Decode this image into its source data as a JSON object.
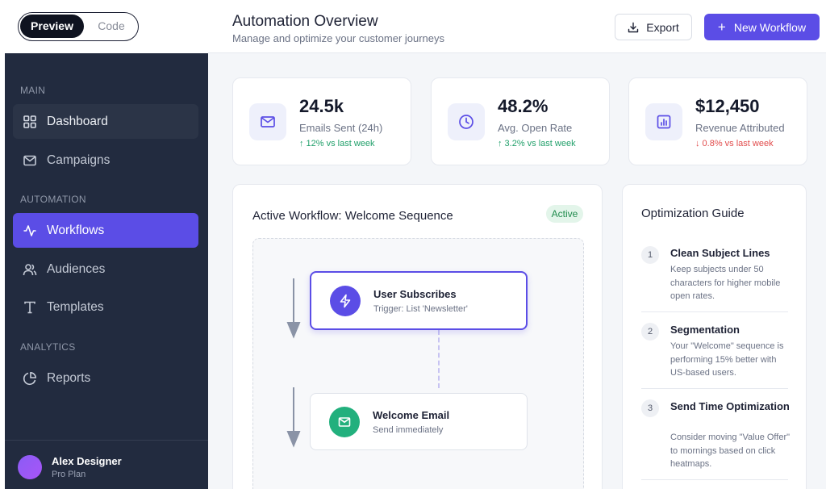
{
  "toggle": {
    "preview": "Preview",
    "code": "Code"
  },
  "sidebar": {
    "sections": {
      "main": "MAIN",
      "automation": "AUTOMATION",
      "analytics": "ANALYTICS"
    },
    "items": [
      {
        "label": "Dashboard",
        "icon": "grid-icon"
      },
      {
        "label": "Campaigns",
        "icon": "mail-icon"
      },
      {
        "label": "Workflows",
        "icon": "activity-icon"
      },
      {
        "label": "Audiences",
        "icon": "users-icon"
      },
      {
        "label": "Templates",
        "icon": "type-icon"
      },
      {
        "label": "Reports",
        "icon": "pie-chart-icon"
      }
    ],
    "user": {
      "name": "Alex Designer",
      "plan": "Pro Plan"
    }
  },
  "header": {
    "title": "Automation Overview",
    "subtitle": "Manage and optimize your customer journeys",
    "export_label": "Export",
    "new_workflow_label": "New Workflow"
  },
  "stats": [
    {
      "value": "24.5k",
      "label": "Emails Sent (24h)",
      "trend": "↑ 12% vs last week",
      "direction": "up",
      "icon": "mail-icon"
    },
    {
      "value": "48.2%",
      "label": "Avg. Open Rate",
      "trend": "↑ 3.2% vs last week",
      "direction": "up",
      "icon": "clock-icon"
    },
    {
      "value": "$12,450",
      "label": "Revenue Attributed",
      "trend": "↓ 0.8% vs last week",
      "direction": "down",
      "icon": "bar-chart-icon"
    }
  ],
  "workflow": {
    "title": "Active Workflow: Welcome Sequence",
    "status": "Active",
    "nodes": [
      {
        "title": "User Subscribes",
        "subtitle": "Trigger: List 'Newsletter'",
        "icon": "zap-icon"
      },
      {
        "title": "Welcome Email",
        "subtitle": "Send immediately",
        "icon": "mail-icon"
      }
    ]
  },
  "guide": {
    "title": "Optimization Guide",
    "tips": [
      {
        "num": "1",
        "title": "Clean Subject Lines",
        "text": "Keep subjects under 50 characters for higher mobile open rates."
      },
      {
        "num": "2",
        "title": "Segmentation",
        "text": "Your \"Welcome\" sequence is performing 15% better with US-based users."
      },
      {
        "num": "3",
        "title": "Send Time Optimization",
        "text": "Consider moving \"Value Offer\" to mornings based on click heatmaps."
      }
    ]
  },
  "colors": {
    "accent": "#5b4de6",
    "sidebar": "#222b3f",
    "success": "#22a06b",
    "danger": "#e14b4b",
    "action_node": "#22b07d"
  }
}
